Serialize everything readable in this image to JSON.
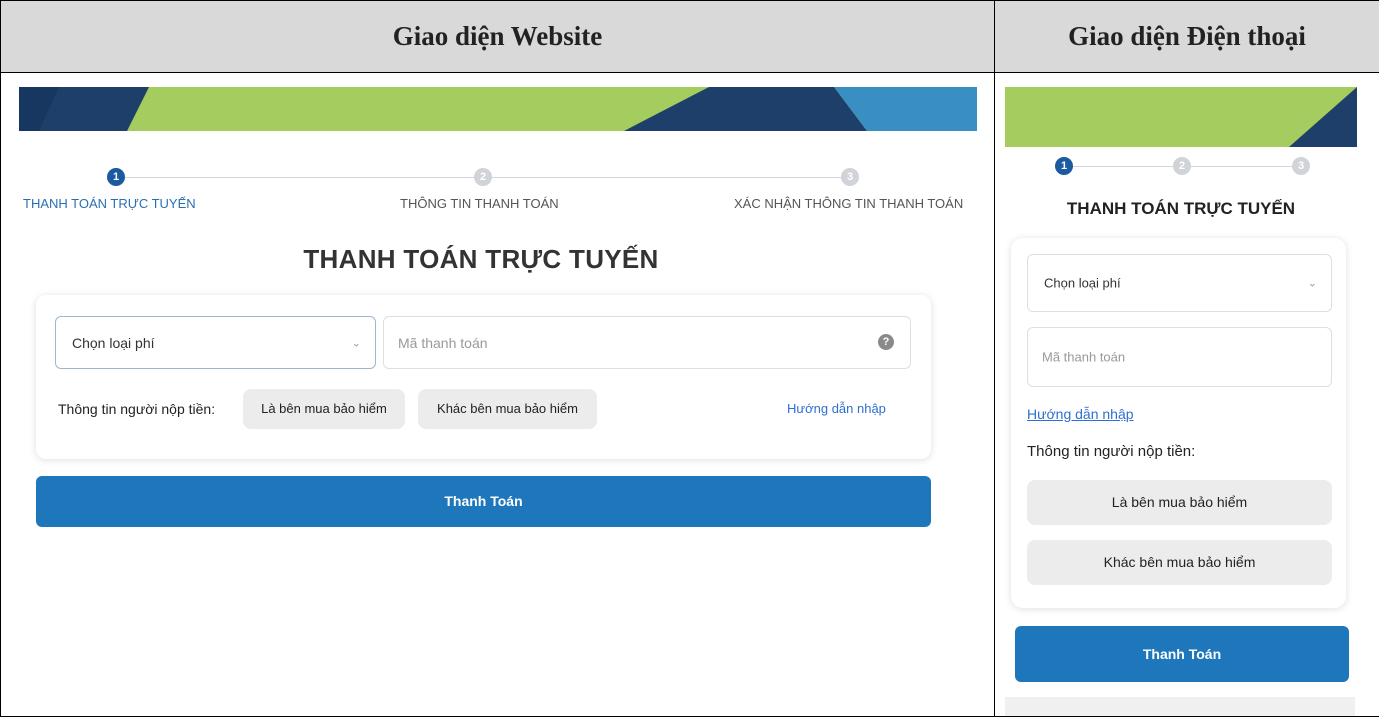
{
  "headers": {
    "website": "Giao diện Website",
    "phone": "Giao diện Điện thoại"
  },
  "website": {
    "steps": [
      {
        "number": "1",
        "label": "THANH TOÁN TRỰC TUYẾN"
      },
      {
        "number": "2",
        "label": "THÔNG TIN THANH TOÁN"
      },
      {
        "number": "3",
        "label": "XÁC NHẬN THÔNG TIN THANH TOÁN"
      }
    ],
    "title": "THANH TOÁN TRỰC TUYẾN",
    "fee_select": "Chọn loại phí",
    "payment_code_placeholder": "Mã thanh toán",
    "help_glyph": "?",
    "payer_label": "Thông tin người nộp tiền:",
    "option_buyer": "Là bên mua bảo hiểm",
    "option_other": "Khác bên mua bảo hiểm",
    "guide_link": "Hướng dẫn nhập",
    "pay_button": "Thanh Toán"
  },
  "phone": {
    "steps": [
      "1",
      "2",
      "3"
    ],
    "title": "THANH TOÁN TRỰC TUYẾN",
    "fee_select": "Chọn loại phí",
    "payment_code_placeholder": "Mã thanh toán",
    "guide_link": "Hướng dẫn nhập",
    "payer_label": "Thông tin người nộp tiền:",
    "option_buyer": "Là bên mua bảo hiểm",
    "option_other": "Khác bên mua bảo hiểm",
    "pay_button": "Thanh Toán"
  },
  "colors": {
    "accent_blue": "#1f77bb",
    "navy": "#1b3f6b",
    "banner_green": "#a4cc5e",
    "link_blue": "#2f6fd1"
  }
}
